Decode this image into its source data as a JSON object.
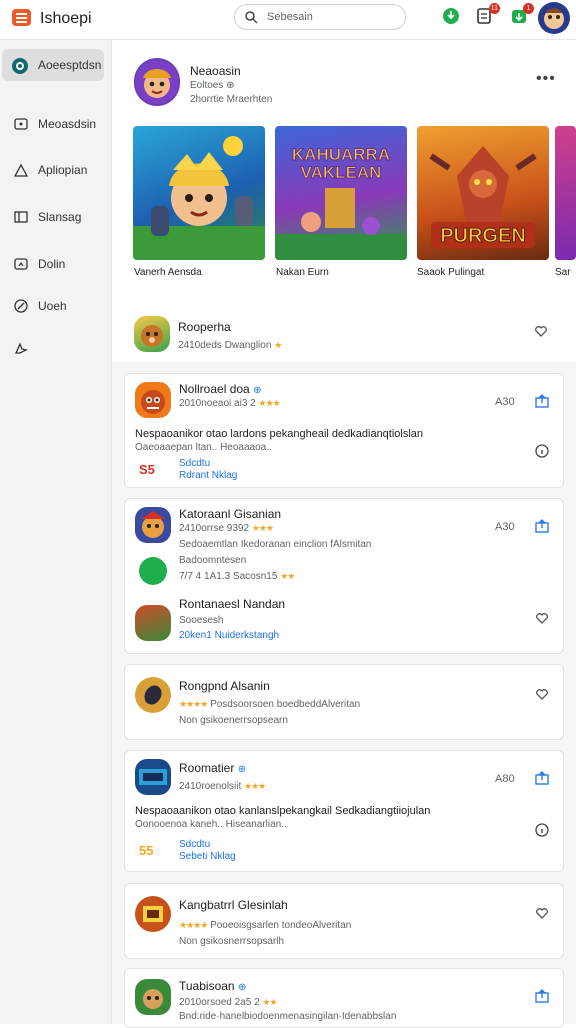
{
  "header": {
    "title": "Ishoepi",
    "search_placeholder": "Sebesain",
    "notif_count": "11",
    "update_count": "1"
  },
  "sidebar": {
    "items": [
      {
        "label": "Aoeesptdsn",
        "icon": "home-icon",
        "active": true
      },
      {
        "label": "Meoasdsin",
        "icon": "games-icon"
      },
      {
        "label": "Apliopian",
        "icon": "apps-icon"
      },
      {
        "label": "Slansag",
        "icon": "books-icon"
      },
      {
        "label": "Dolin",
        "icon": "library-icon"
      },
      {
        "label": "Uoeh",
        "icon": "offers-icon"
      },
      {
        "label": "",
        "icon": "profile-icon"
      }
    ]
  },
  "featured": {
    "dev_name": "Neaoasin",
    "dev_sub": "Eoltoes ⊕",
    "dev_meta": "2horrtie Mraerhten",
    "thumbs": [
      {
        "caption": "Vanerh Aensda",
        "art": "adventure"
      },
      {
        "caption": "Nakan Eurn",
        "art": "kahuarra",
        "overlay": "KAHUARRA\nVAKLEAN"
      },
      {
        "caption": "Saaok Pulingat",
        "art": "purgen",
        "overlay": "PURGEN"
      },
      {
        "caption": "Sar",
        "art": "partial"
      }
    ]
  },
  "list_header": {
    "title": "Rooperha",
    "meta": "2410deds Dwanglion"
  },
  "cards": [
    {
      "title": "Nollroael doa",
      "verified": "⊕",
      "meta": "2010noeaoi ai3 2",
      "stars": "★★★",
      "rating": "A30",
      "desc": "Nespaoanikor otao lardons pekangheail dedkadianqtiolslan",
      "sub": "Oaeoaaepan ltan.. Heoaaaoa..",
      "logo": "S5",
      "link1": "Sdcdtu",
      "link2": "Rdrant Nklag"
    },
    {
      "title": "Katoraanl Gisanian",
      "meta": "2410orrse 9392",
      "stars": "★★★",
      "rating": "A30",
      "desc": "Sedoaemtlan Ikedoranan einclion fAlsmitan",
      "sub": "Badoomntesen",
      "meta2": "7/7 4 1A1.3 Sacosn15",
      "stars2": "★★"
    },
    {
      "title": "Rontanaesl Nandan",
      "meta": "Sooesesh",
      "link1": "20ken1",
      "link2": "Nuiderkstangh"
    },
    {
      "title": "Rongpnd Alsanin",
      "stars": "★★★★",
      "meta": "Posdsoorsoen",
      "meta_b": "boedbeddAlveritan",
      "sub": "Non gsikoenerrsopsearn"
    },
    {
      "title": "Roomatier",
      "verified": "⊕",
      "meta": "2410roenolsiit",
      "stars": "★★★",
      "rating": "A80",
      "desc": "Nespaoaanikon otao kanlanslpekangkail Sedkadiangtiiojulan",
      "sub": "Oonooenoa kaneh.. Hiseanarlian..",
      "logo": "55",
      "link1": "Sdcdtu",
      "link2": "Sebeti Nklag"
    },
    {
      "title": "Kangbatrrl Glesinlah",
      "stars": "★★★★",
      "meta": "Pooeoisgsarlen",
      "meta_b": "tondeoAlveritan",
      "sub": "Non gsikosnerrsopsarlh"
    },
    {
      "title": "Tuabisoan",
      "verified": "⊕",
      "meta": "2010orsoed 2a5 2",
      "stars": "★★",
      "sub": "Bnd:ride·hanelbiodoenmenasingilan·Idenabbslan"
    }
  ],
  "colors": {
    "accent": "#1a73e8",
    "brand": "#ea5a2b",
    "star": "#f5a623",
    "green": "#1fae4b"
  }
}
